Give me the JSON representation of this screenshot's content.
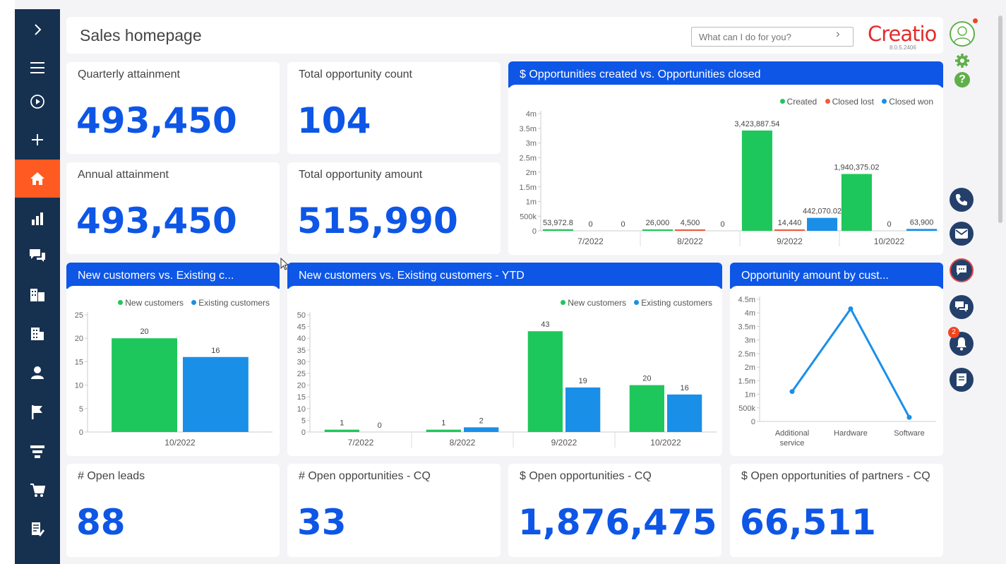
{
  "header": {
    "title": "Sales homepage",
    "search_placeholder": "What can I do for you?",
    "logo": "Creatio",
    "version": "8.0.5.2406"
  },
  "sidebar": {
    "items": [
      {
        "icon": "chevron-right-icon"
      },
      {
        "icon": "menu-icon"
      },
      {
        "icon": "play-icon"
      },
      {
        "icon": "plus-icon"
      },
      {
        "icon": "home-icon",
        "active": true
      },
      {
        "icon": "bar-chart-icon"
      },
      {
        "icon": "chat-bubbles-icon"
      },
      {
        "icon": "accounts-icon"
      },
      {
        "icon": "building-icon"
      },
      {
        "icon": "contact-icon"
      },
      {
        "icon": "flag-icon"
      },
      {
        "icon": "funnel-icon"
      },
      {
        "icon": "cart-icon"
      },
      {
        "icon": "document-edit-icon"
      }
    ],
    "active_color": "#ff5a21",
    "background_color": "#16304f"
  },
  "metrics": {
    "quarterly_attainment": {
      "title": "Quarterly attainment",
      "value": "493,450"
    },
    "total_opportunity_count": {
      "title": "Total opportunity count",
      "value": "104"
    },
    "annual_attainment": {
      "title": "Annual attainment",
      "value": "493,450"
    },
    "total_opportunity_amount": {
      "title": "Total opportunity amount",
      "value": "515,990"
    },
    "open_leads": {
      "title": "# Open leads",
      "value": "88"
    },
    "open_opportunities_cq": {
      "title": "# Open opportunities - CQ",
      "value": "33"
    },
    "open_opportunities_amount_cq": {
      "title": "$ Open opportunities - CQ",
      "value": "1,876,475"
    },
    "open_opportunities_partners_cq": {
      "title": "$ Open opportunities of partners - CQ",
      "value": "66,511"
    }
  },
  "colors": {
    "accent_blue": "#0d56e6",
    "green": "#1ec75b",
    "blue": "#1a8fe8",
    "red": "#f05a3c"
  },
  "chart_data": [
    {
      "id": "opps_created_closed",
      "type": "bar",
      "title": "$ Opportunities created vs. Opportunities closed",
      "categories": [
        "7/2022",
        "8/2022",
        "9/2022",
        "10/2022"
      ],
      "series": [
        {
          "name": "Created",
          "values": [
            53972.8,
            26000,
            3423887.54,
            1940375.02
          ],
          "labels": [
            "53,972.8",
            "26,000",
            "3,423,887.54",
            "1,940,375.02"
          ]
        },
        {
          "name": "Closed lost",
          "values": [
            0,
            4500,
            14440,
            0
          ],
          "labels": [
            "0",
            "4,500",
            "14,440",
            "0"
          ]
        },
        {
          "name": "Closed won",
          "values": [
            0,
            0,
            442070.02,
            63900
          ],
          "labels": [
            "0",
            "0",
            "442,070.02",
            "63,900"
          ]
        }
      ],
      "yticks": [
        "0",
        "500k",
        "1m",
        "1.5m",
        "2m",
        "2.5m",
        "3m",
        "3.5m",
        "4m"
      ],
      "ylim": [
        0,
        4000000
      ],
      "legend": "top-right"
    },
    {
      "id": "new_vs_existing",
      "type": "bar",
      "title": "New customers vs. Existing c...",
      "categories": [
        "10/2022"
      ],
      "series": [
        {
          "name": "New customers",
          "values": [
            20
          ]
        },
        {
          "name": "Existing customers",
          "values": [
            16
          ]
        }
      ],
      "yticks": [
        "0",
        "5",
        "10",
        "15",
        "20",
        "25"
      ],
      "ylim": [
        0,
        25
      ],
      "legend": "top-right"
    },
    {
      "id": "new_vs_existing_ytd",
      "type": "bar",
      "title": "New customers vs. Existing customers - YTD",
      "categories": [
        "7/2022",
        "8/2022",
        "9/2022",
        "10/2022"
      ],
      "series": [
        {
          "name": "New customers",
          "values": [
            1,
            1,
            43,
            20
          ]
        },
        {
          "name": "Existing customers",
          "values": [
            0,
            2,
            19,
            16
          ]
        }
      ],
      "yticks": [
        "0",
        "5",
        "10",
        "15",
        "20",
        "25",
        "30",
        "35",
        "40",
        "45",
        "50"
      ],
      "ylim": [
        0,
        50
      ],
      "legend": "top-right"
    },
    {
      "id": "amount_by_customer",
      "type": "line",
      "title": "Opportunity amount by cust...",
      "categories": [
        "Additional service",
        "Hardware",
        "Software"
      ],
      "series": [
        {
          "values": [
            1100000,
            4150000,
            150000
          ]
        }
      ],
      "yticks": [
        "0",
        "500k",
        "1m",
        "1.5m",
        "2m",
        "2.5m",
        "3m",
        "3.5m",
        "4m",
        "4.5m"
      ],
      "ylim": [
        0,
        4500000
      ]
    }
  ],
  "rightbar": {
    "notification_count": "2",
    "icons": [
      "profile-icon",
      "gear-icon",
      "help-icon",
      "phone-icon",
      "email-icon",
      "chat-icon",
      "feed-icon",
      "notifications-icon",
      "tasks-icon"
    ]
  }
}
